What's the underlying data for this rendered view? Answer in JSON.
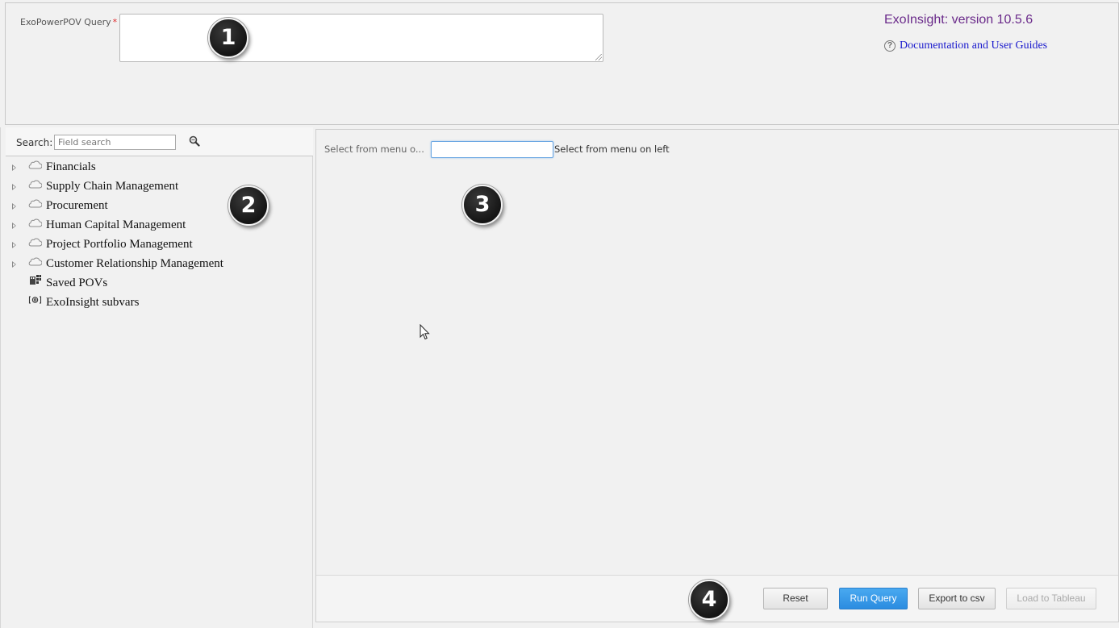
{
  "query": {
    "label": "ExoPowerPOV Query",
    "required_marker": "*",
    "value": ""
  },
  "header": {
    "version": "ExoInsight: version 10.5.6",
    "doc_link": "Documentation and User Guides",
    "help_icon": "question-circle-icon"
  },
  "search": {
    "label": "Search:",
    "placeholder": "Field search",
    "icon": "magnifier-icon"
  },
  "tree": {
    "items": [
      {
        "label": "Financials",
        "icon": "cloud-icon",
        "expandable": true
      },
      {
        "label": "Supply Chain Management",
        "icon": "cloud-icon",
        "expandable": true
      },
      {
        "label": "Procurement",
        "icon": "cloud-icon",
        "expandable": true
      },
      {
        "label": "Human Capital Management",
        "icon": "cloud-icon",
        "expandable": true
      },
      {
        "label": "Project Portfolio Management",
        "icon": "cloud-icon",
        "expandable": true
      },
      {
        "label": "Customer Relationship Management",
        "icon": "cloud-icon",
        "expandable": true
      },
      {
        "label": "Saved POVs",
        "icon": "saved-povs-icon",
        "expandable": false
      },
      {
        "label": "ExoInsight subvars",
        "icon": "subvars-icon",
        "expandable": false
      }
    ]
  },
  "selection": {
    "label": "Select from menu o...",
    "value": "",
    "hint": "Select from menu on left"
  },
  "buttons": {
    "reset": "Reset",
    "run_query": "Run Query",
    "export_csv": "Export to csv",
    "load_tableau": "Load to Tableau"
  },
  "callouts": [
    "1",
    "2",
    "3",
    "4"
  ],
  "colors": {
    "version_text": "#6a2a8a",
    "link": "#1a1acd",
    "primary_button": "#2b8ce0",
    "required": "#e0282a"
  }
}
